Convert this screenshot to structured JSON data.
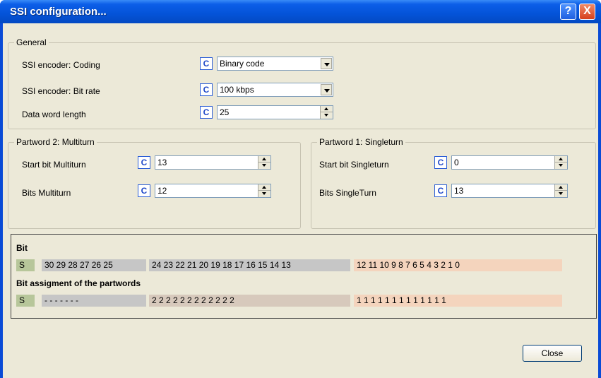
{
  "window": {
    "title": "SSI configuration...",
    "help_label": "?",
    "close_label": "X"
  },
  "general": {
    "legend": "General",
    "coding_label": "SSI encoder: Coding",
    "coding_value": "Binary code",
    "bitrate_label": "SSI encoder: Bit rate",
    "bitrate_value": "100 kbps",
    "wordlen_label": "Data word length",
    "wordlen_value": "25"
  },
  "partword2": {
    "legend": "Partword 2: Multiturn",
    "start_label": "Start bit Multiturn",
    "start_value": "13",
    "bits_label": "Bits Multiturn",
    "bits_value": "12"
  },
  "partword1": {
    "legend": "Partword 1: Singleturn",
    "start_label": "Start bit Singleturn",
    "start_value": "0",
    "bits_label": "Bits SingleTurn",
    "bits_value": "13"
  },
  "c_label": "C",
  "bits": {
    "heading": "Bit",
    "s": "S",
    "group_gray": "30 29 28 27 26 25",
    "group_mt": "24 23 22 21 20 19 18 17 16 15 14 13",
    "group_st": "12 11 10  9   8   7   6   5   4   3   2   1   0"
  },
  "assignment": {
    "heading": "Bit assigment of the partwords",
    "s": "S",
    "group_gray": "-   -   -   -   -   -   -",
    "group_mt": "2   2   2   2   2   2   2   2   2   2   2   2",
    "group_st": "1   1   1   1   1   1   1   1   1   1   1   1   1"
  },
  "colors": {
    "s": "#b7c69a",
    "unused": "#c6c6c6",
    "multiturn": "#d7c9bc",
    "singleturn": "#f4d4bd"
  },
  "close_button": "Close"
}
